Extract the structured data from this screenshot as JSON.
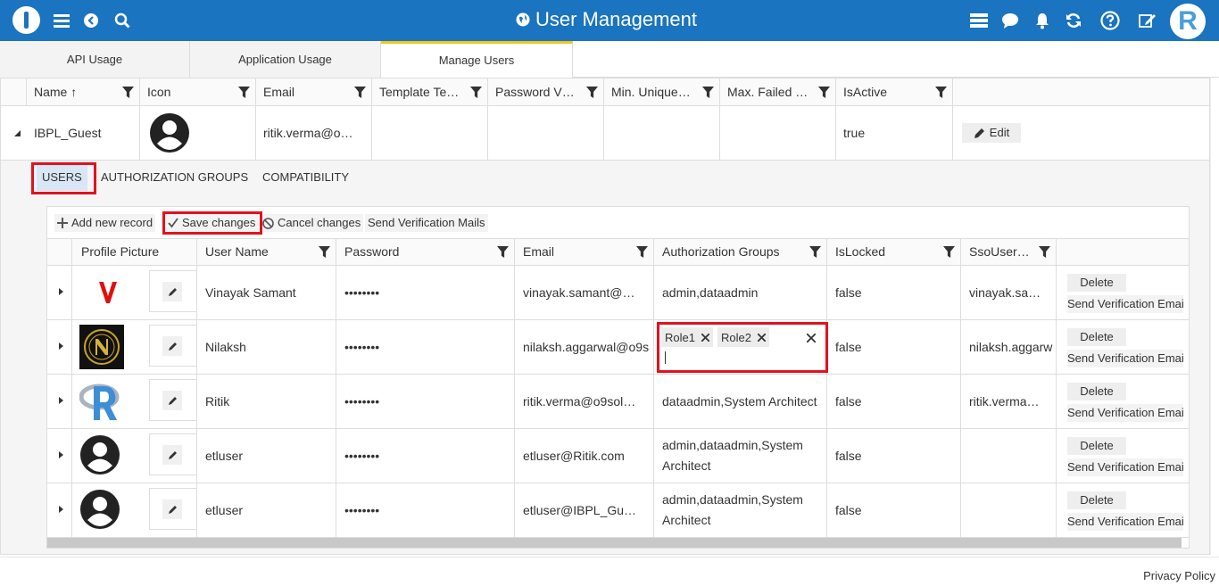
{
  "header": {
    "title": "User Management",
    "avatar_letter": "R"
  },
  "main_tabs": [
    "API Usage",
    "Application Usage",
    "Manage Users"
  ],
  "main_grid": {
    "columns": [
      "Name ↑",
      "Icon",
      "Email",
      "Template Te…",
      "Password V…",
      "Min. Unique…",
      "Max. Failed …",
      "IsActive"
    ],
    "row": {
      "name": "IBPL_Guest",
      "email": "ritik.verma@o…",
      "is_active": "true",
      "edit_label": "Edit"
    }
  },
  "sub_tabs": [
    "USERS",
    "AUTHORIZATION GROUPS",
    "COMPATIBILITY"
  ],
  "toolbar": {
    "add": "Add new record",
    "save": "Save changes",
    "cancel": "Cancel changes",
    "send": "Send Verification Mails"
  },
  "users_grid": {
    "columns": [
      "Profile Picture",
      "User Name",
      "Password",
      "Email",
      "Authorization Groups",
      "IsLocked",
      "SsoUser…"
    ],
    "rows": [
      {
        "user": "Vinayak Samant",
        "password": "••••••••",
        "email": "vinayak.samant@…",
        "groups": "admin,dataadmin",
        "locked": "false",
        "sso": "vinayak.sa…",
        "delete": "Delete",
        "send": "Send Verification Email"
      },
      {
        "user": "Nilaksh",
        "password": "••••••••",
        "email": "nilaksh.aggarwal@o9s",
        "groups": "",
        "locked": "false",
        "sso": "nilaksh.aggarw",
        "delete": "Delete",
        "send": "Send Verification Email"
      },
      {
        "user": "Ritik",
        "password": "••••••••",
        "email": "ritik.verma@o9sol…",
        "groups": "dataadmin,System Architect",
        "locked": "false",
        "sso": "ritik.verma…",
        "delete": "Delete",
        "send": "Send Verification Email"
      },
      {
        "user": "etluser",
        "password": "••••••••",
        "email": "etluser@Ritik.com",
        "groups": "admin,dataadmin,System Architect",
        "locked": "false",
        "sso": "",
        "delete": "Delete",
        "send": "Send Verification Email"
      },
      {
        "user": "etluser",
        "password": "••••••••",
        "email": "etluser@IBPL_Gu…",
        "groups": "admin,dataadmin,System Architect",
        "locked": "false",
        "sso": "",
        "delete": "Delete",
        "send": "Send Verification Email"
      }
    ],
    "editor_chips": [
      "Role1",
      "Role2"
    ]
  },
  "footer": {
    "privacy": "Privacy Policy"
  },
  "colors": {
    "brand": "#1a74bf",
    "highlight": "#e3101f",
    "active_tab_border": "#f5c518"
  }
}
